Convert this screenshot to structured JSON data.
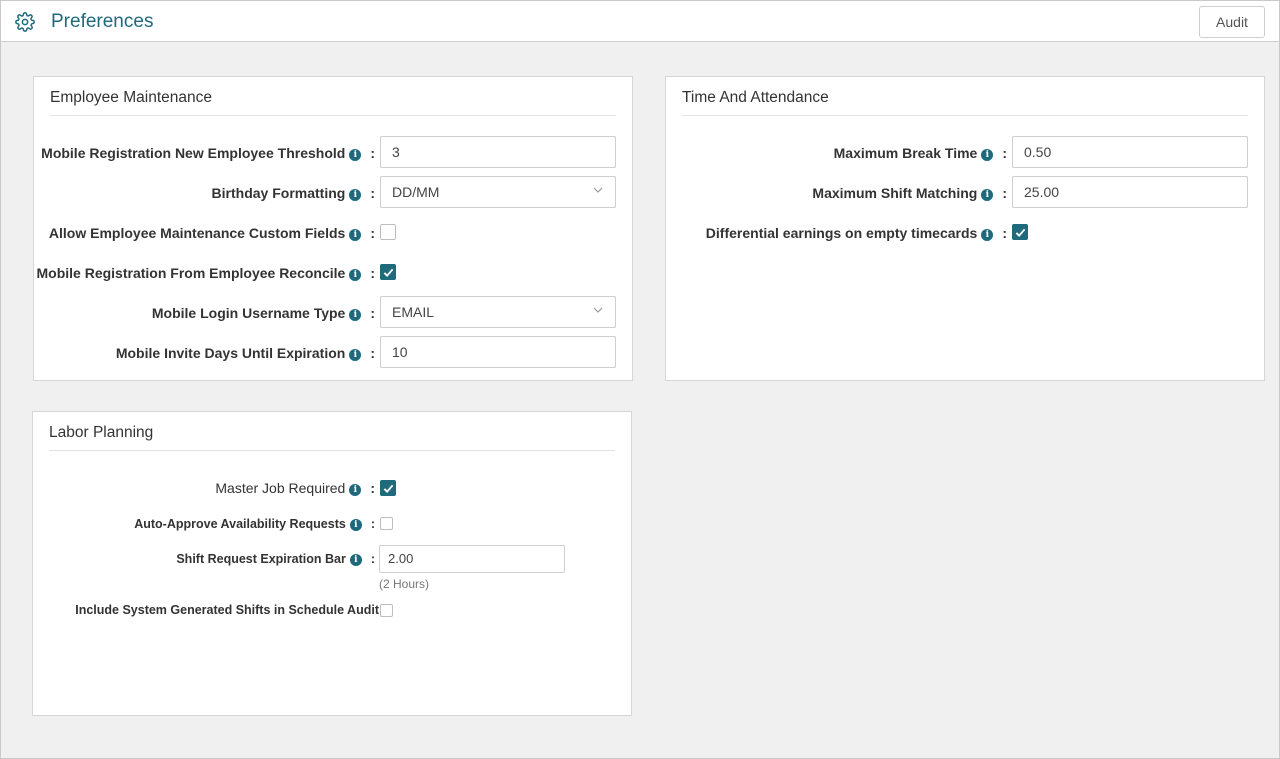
{
  "header": {
    "title": "Preferences",
    "audit_label": "Audit"
  },
  "employee_maintenance": {
    "title": "Employee Maintenance",
    "threshold_label": "Mobile Registration New Employee Threshold",
    "threshold_value": "3",
    "birthday_label": "Birthday Formatting",
    "birthday_value": "DD/MM",
    "custom_fields_label": "Allow Employee Maintenance Custom Fields",
    "custom_fields_checked": false,
    "reconcile_label": "Mobile Registration From Employee Reconcile",
    "reconcile_checked": true,
    "username_type_label": "Mobile Login Username Type",
    "username_type_value": "EMAIL",
    "invite_days_label": "Mobile Invite Days Until Expiration",
    "invite_days_value": "10"
  },
  "time_attendance": {
    "title": "Time And Attendance",
    "break_label": "Maximum Break Time",
    "break_value": "0.50",
    "shift_matching_label": "Maximum Shift Matching",
    "shift_matching_value": "25.00",
    "differential_label": "Differential earnings on empty timecards",
    "differential_checked": true
  },
  "labor_planning": {
    "title": "Labor Planning",
    "master_job_label": "Master Job Required",
    "master_job_checked": true,
    "auto_approve_label": "Auto-Approve Availability Requests",
    "auto_approve_checked": false,
    "expiration_bar_label": "Shift Request Expiration Bar",
    "expiration_bar_value": "2.00",
    "expiration_bar_hint": "(2 Hours)",
    "system_shifts_label": "Include System Generated Shifts in Schedule Audit",
    "system_shifts_checked": false
  },
  "colors": {
    "accent": "#1f6a7c",
    "background": "#f0f0f0"
  },
  "icons": {
    "header": "gear-icon",
    "info": "info-icon",
    "dropdown": "chevron-down-icon",
    "check": "check-icon"
  }
}
